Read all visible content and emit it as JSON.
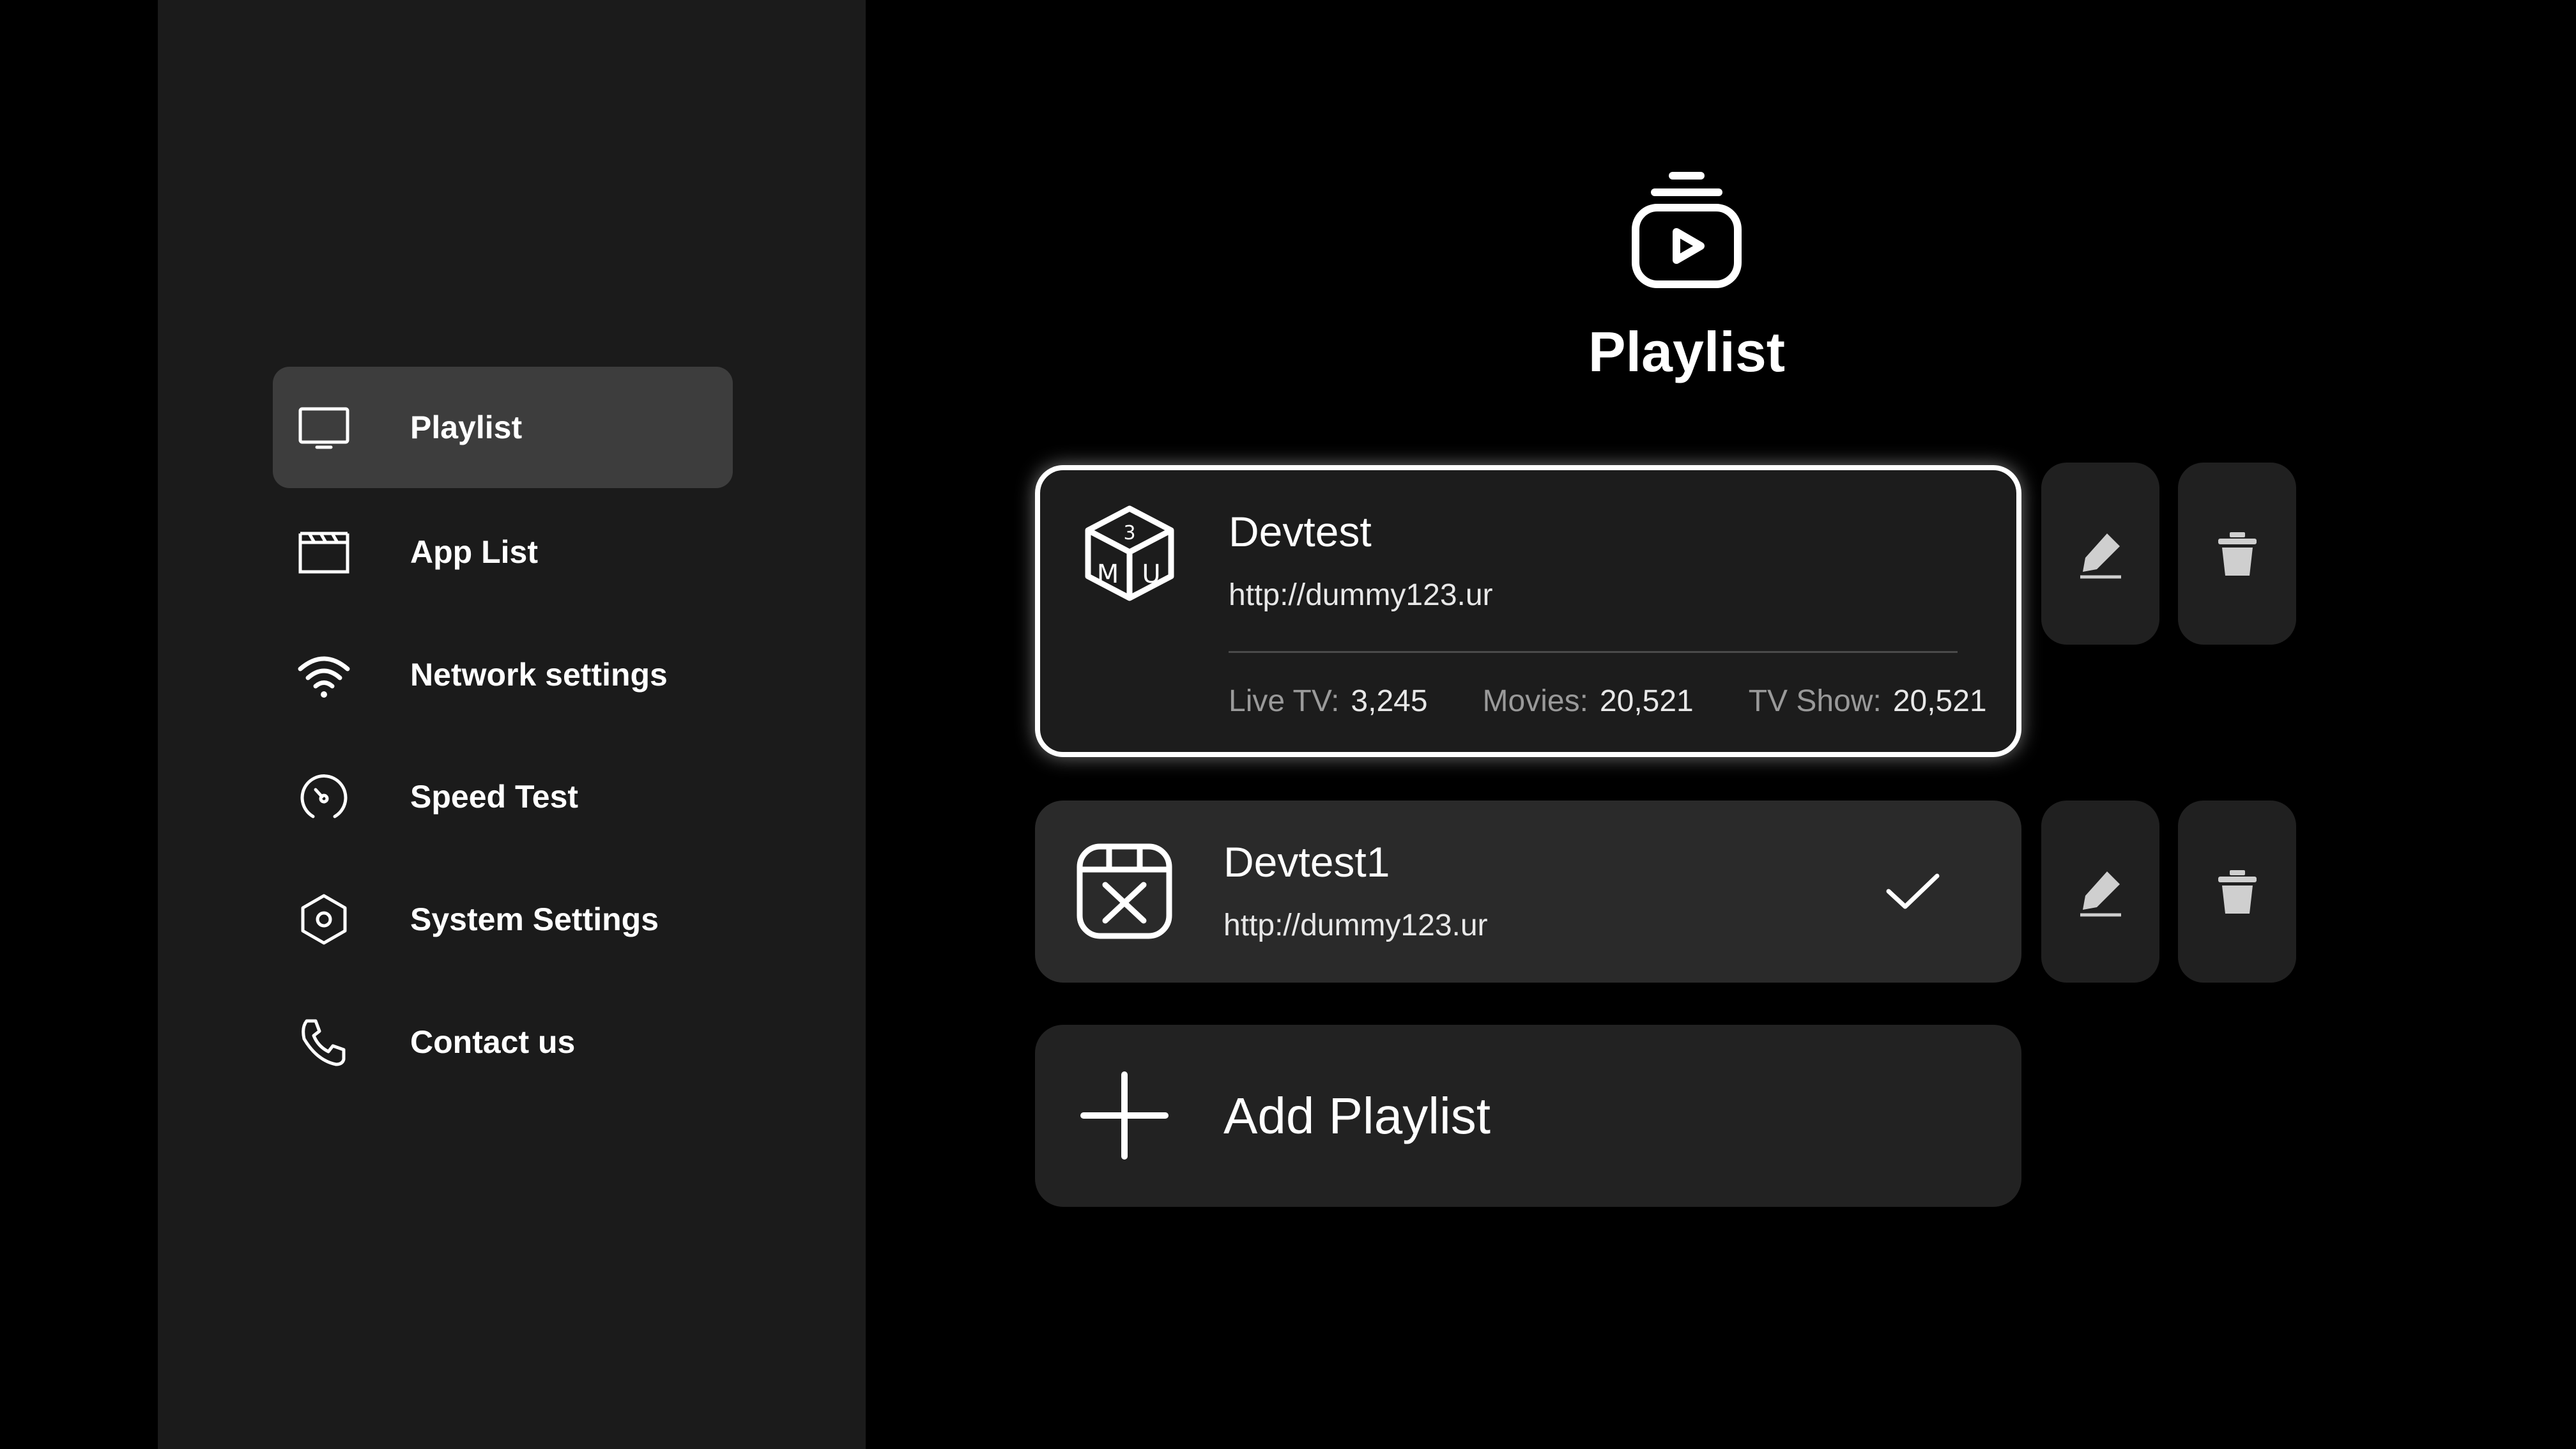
{
  "sidebar": {
    "items": [
      {
        "label": "Playlist",
        "icon": "tv-icon",
        "active": true
      },
      {
        "label": "App List",
        "icon": "clapperboard-icon"
      },
      {
        "label": "Network settings",
        "icon": "wifi-icon"
      },
      {
        "label": "Speed Test",
        "icon": "speedometer-icon"
      },
      {
        "label": "System Settings",
        "icon": "hexagon-settings-icon"
      },
      {
        "label": "Contact us",
        "icon": "phone-icon"
      }
    ]
  },
  "header": {
    "icon": "playlist-play-icon",
    "title": "Playlist"
  },
  "playlists": [
    {
      "name": "Devtest",
      "url": "http://dummy123.ur",
      "icon": "m3u-cube-icon",
      "stats": [
        {
          "label": "Live TV:",
          "value": "3,245"
        },
        {
          "label": "Movies:",
          "value": "20,521"
        },
        {
          "label": "TV Show:",
          "value": "20,521"
        }
      ]
    },
    {
      "name": "Devtest1",
      "url": "http://dummy123.ur",
      "icon": "xtream-icon",
      "selected": true
    }
  ],
  "add_playlist": {
    "label": "Add Playlist",
    "icon": "plus-icon"
  },
  "colors": {
    "background": "#000000",
    "sidebar": "#1b1b1b",
    "active_item": "#3d3d3d",
    "card": "#2a2a2a",
    "focused_border": "#ffffff"
  }
}
